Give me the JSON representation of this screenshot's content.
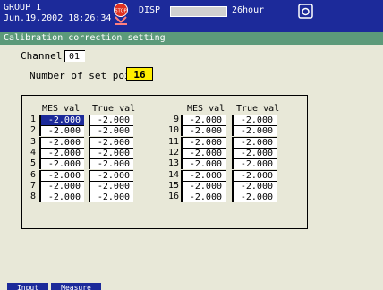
{
  "header": {
    "group": "GROUP 1",
    "datetime": "Jun.19.2002 18:26:34",
    "stop_icon_label": "STOP",
    "disp": "DISP",
    "mode": "26hour"
  },
  "title": "Calibration correction setting",
  "channel": {
    "label": "Channel",
    "value": "01"
  },
  "set_points": {
    "label": "Number of set points",
    "value": "16"
  },
  "columns": {
    "mes": "MES val",
    "true": "True val"
  },
  "rows": [
    {
      "n": "1",
      "mes": "-2.000",
      "tru": "-2.000"
    },
    {
      "n": "2",
      "mes": "-2.000",
      "tru": "-2.000"
    },
    {
      "n": "3",
      "mes": "-2.000",
      "tru": "-2.000"
    },
    {
      "n": "4",
      "mes": "-2.000",
      "tru": "-2.000"
    },
    {
      "n": "5",
      "mes": "-2.000",
      "tru": "-2.000"
    },
    {
      "n": "6",
      "mes": "-2.000",
      "tru": "-2.000"
    },
    {
      "n": "7",
      "mes": "-2.000",
      "tru": "-2.000"
    },
    {
      "n": "8",
      "mes": "-2.000",
      "tru": "-2.000"
    },
    {
      "n": "9",
      "mes": "-2.000",
      "tru": "-2.000"
    },
    {
      "n": "10",
      "mes": "-2.000",
      "tru": "-2.000"
    },
    {
      "n": "11",
      "mes": "-2.000",
      "tru": "-2.000"
    },
    {
      "n": "12",
      "mes": "-2.000",
      "tru": "-2.000"
    },
    {
      "n": "13",
      "mes": "-2.000",
      "tru": "-2.000"
    },
    {
      "n": "14",
      "mes": "-2.000",
      "tru": "-2.000"
    },
    {
      "n": "15",
      "mes": "-2.000",
      "tru": "-2.000"
    },
    {
      "n": "16",
      "mes": "-2.000",
      "tru": "-2.000"
    }
  ],
  "softkeys": [
    "Input",
    "Measure"
  ],
  "colors": {
    "header_bg": "#1c2a9a",
    "title_bg": "#5c9a7a",
    "highlight": "#ffee00",
    "body_bg": "#e8e8d8"
  }
}
